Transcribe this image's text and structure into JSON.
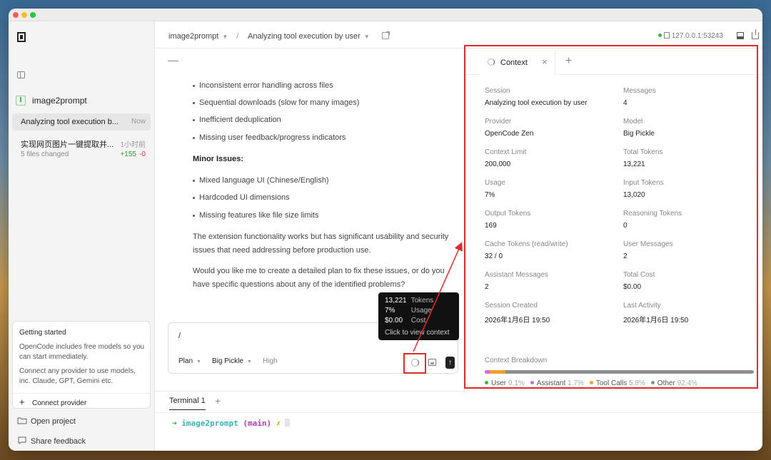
{
  "window": {
    "traffic_lights": [
      "#ff5f57",
      "#febc2e",
      "#28c840"
    ]
  },
  "sidebar": {
    "project_badge": "I",
    "project_name": "image2prompt",
    "sessions": [
      {
        "title": "Analyzing tool execution b...",
        "time": "Now"
      },
      {
        "title": "实现网页图片一键提取并...",
        "time": "1小时前",
        "files": "5 files changed",
        "additions": "+155",
        "deletions": "-0"
      }
    ],
    "getting_started": {
      "title": "Getting started",
      "p1": "OpenCode includes free models so you can start immediately.",
      "p2": "Connect any provider to use models, inc. Claude, GPT, Gemini etc.",
      "button": "Connect provider"
    },
    "open_project": "Open project",
    "share_feedback": "Share feedback"
  },
  "header": {
    "project": "image2prompt",
    "separator": "/",
    "session": "Analyzing tool execution by user",
    "server": "127.0.0.1:53243"
  },
  "chat": {
    "bullets_top": [
      "Inconsistent error handling across files",
      "Sequential downloads (slow for many images)",
      "Inefficient deduplication",
      "Missing user feedback/progress indicators"
    ],
    "minor_heading": "Minor Issues:",
    "bullets_minor": [
      "Mixed language UI (Chinese/English)",
      "Hardcoded UI dimensions",
      "Missing features like file size limits"
    ],
    "para1": "The extension functionality works but has significant usability and security issues that need addressing before production use.",
    "para2": "Would you like me to create a detailed plan to fix these issues, or do you have specific questions about any of the identified problems?"
  },
  "composer": {
    "value": "/",
    "mode": "Plan",
    "model": "Big Pickle",
    "effort": "High"
  },
  "tooltip": {
    "tokens_value": "13,221",
    "tokens_label": "Tokens",
    "usage_value": "7%",
    "usage_label": "Usage",
    "cost_value": "$0.00",
    "cost_label": "Cost",
    "hint": "Click to view context"
  },
  "terminal": {
    "tab": "Terminal 1",
    "prompt_arrow": "➜",
    "dir": "image2prompt",
    "git": "(main)",
    "mark": "✗"
  },
  "context": {
    "tab_label": "Context",
    "fields": [
      {
        "label": "Session",
        "value": "Analyzing tool execution by user"
      },
      {
        "label": "Messages",
        "value": "4"
      },
      {
        "label": "Provider",
        "value": "OpenCode Zen"
      },
      {
        "label": "Model",
        "value": "Big Pickle"
      },
      {
        "label": "Context Limit",
        "value": "200,000"
      },
      {
        "label": "Total Tokens",
        "value": "13,221"
      },
      {
        "label": "Usage",
        "value": "7%"
      },
      {
        "label": "Input Tokens",
        "value": "13,020"
      },
      {
        "label": "Output Tokens",
        "value": "169"
      },
      {
        "label": "Reasoning Tokens",
        "value": "0"
      },
      {
        "label": "Cache Tokens (read/write)",
        "value": "32 / 0"
      },
      {
        "label": "User Messages",
        "value": "2"
      },
      {
        "label": "Assistant Messages",
        "value": "2"
      },
      {
        "label": "Total Cost",
        "value": "$0.00"
      },
      {
        "label": "Session Created",
        "value": "2026年1月6日 19:50"
      },
      {
        "label": "Last Activity",
        "value": "2026年1月6日 19:50"
      }
    ],
    "breakdown_title": "Context Breakdown",
    "breakdown": [
      {
        "name": "User",
        "pct": "0.1%",
        "value": 0.1,
        "color": "#3cb43c"
      },
      {
        "name": "Assistant",
        "pct": "1.7%",
        "value": 1.7,
        "color": "#d66ad6"
      },
      {
        "name": "Tool Calls",
        "pct": "5.8%",
        "value": 5.8,
        "color": "#f0a030"
      },
      {
        "name": "Other",
        "pct": "92.4%",
        "value": 92.4,
        "color": "#8f8f8f"
      }
    ]
  },
  "colors": {
    "highlight": "#e12a2a",
    "accent_green": "#2b9a2b",
    "danger": "#d33333"
  }
}
